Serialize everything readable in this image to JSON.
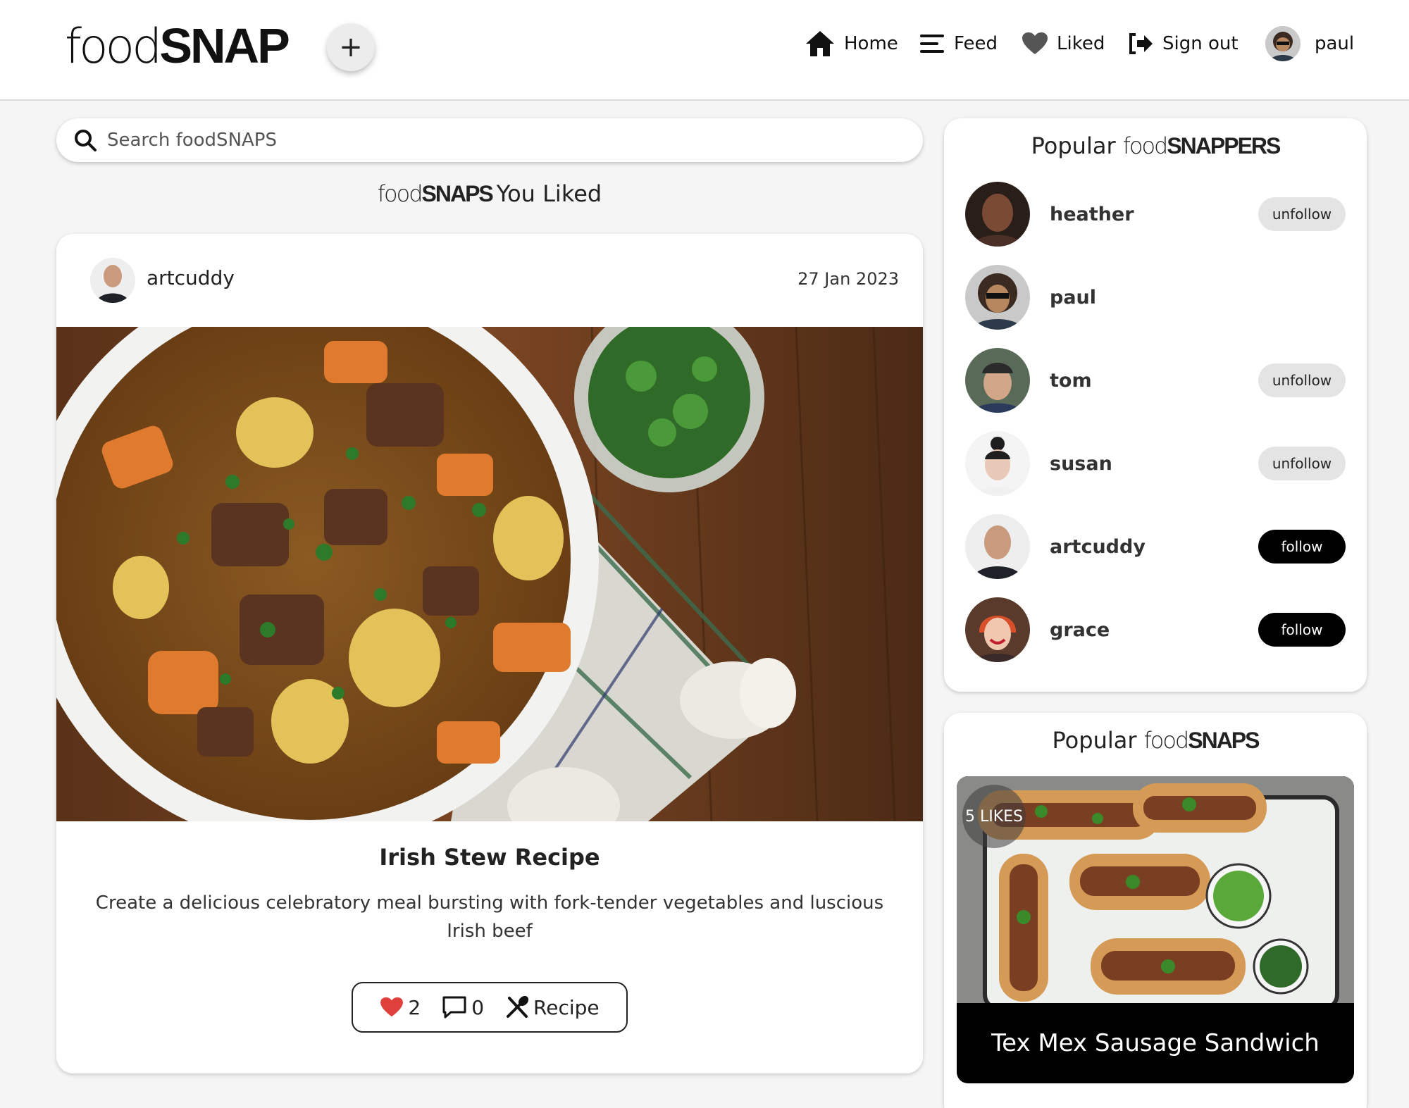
{
  "brand": {
    "logo_thin": "food",
    "logo_bold": "SNAP"
  },
  "nav": {
    "home": "Home",
    "feed": "Feed",
    "liked": "Liked",
    "sign_out": "Sign out",
    "user": "paul"
  },
  "add_button": "+",
  "search": {
    "placeholder": "Search foodSNAPS"
  },
  "section": {
    "title_thin": "food",
    "title_bold": "SNAPS",
    "title_rest": "You Liked"
  },
  "post": {
    "username": "artcuddy",
    "date": "27 Jan 2023",
    "title": "Irish Stew Recipe",
    "description": "Create a delicious celebratory meal bursting with fork-tender vegetables and luscious Irish beef",
    "likes": "2",
    "comments": "0",
    "recipe_label": "Recipe"
  },
  "popular_snappers": {
    "title_prefix": "Popular",
    "title_thin": "food",
    "title_bold": "SNAPPERS",
    "users": [
      {
        "name": "heather",
        "action": "unfollow"
      },
      {
        "name": "paul",
        "action": ""
      },
      {
        "name": "tom",
        "action": "unfollow"
      },
      {
        "name": "susan",
        "action": "unfollow"
      },
      {
        "name": "artcuddy",
        "action": "follow"
      },
      {
        "name": "grace",
        "action": "follow"
      }
    ]
  },
  "popular_snaps": {
    "title_prefix": "Popular",
    "title_thin": "food",
    "title_bold": "SNAPS",
    "item": {
      "likes": "5 LIKES",
      "title": "Tex Mex Sausage Sandwich"
    }
  },
  "colors": {
    "accent": "#000000",
    "heart": "#e0403c",
    "unfollow_bg": "#e4e4e4"
  }
}
